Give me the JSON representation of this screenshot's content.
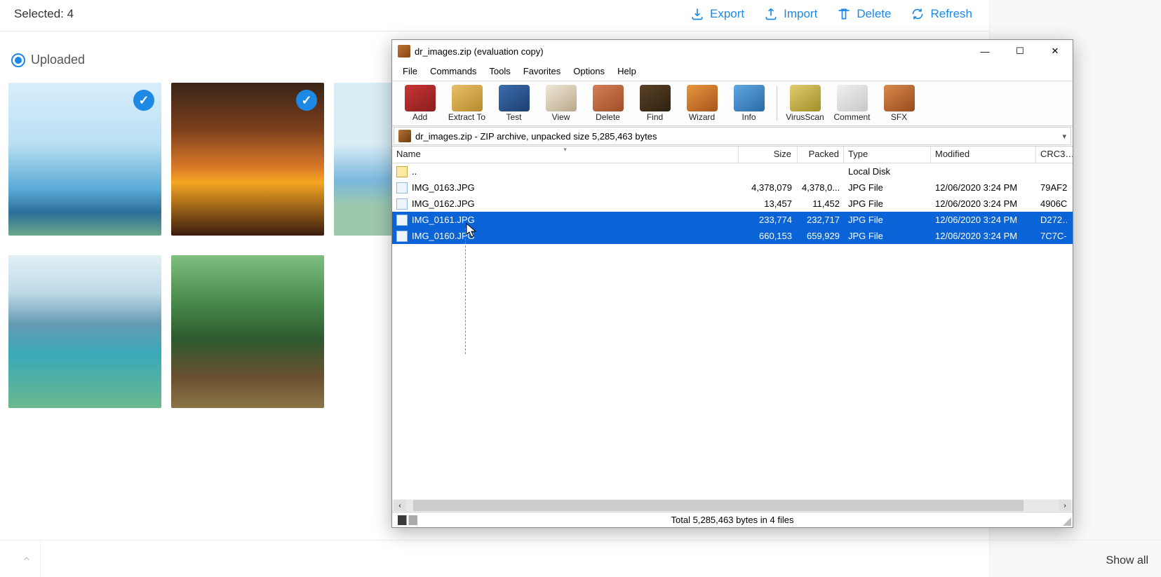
{
  "bg": {
    "selected_text": "Selected: 4",
    "actions": {
      "export": "Export",
      "import": "Import",
      "delete": "Delete",
      "refresh": "Refresh"
    },
    "uploaded_label": "Uploaded",
    "show_all": "Show all"
  },
  "winrar": {
    "title": "dr_images.zip (evaluation copy)",
    "menu": {
      "file": "File",
      "commands": "Commands",
      "tools": "Tools",
      "favorites": "Favorites",
      "options": "Options",
      "help": "Help"
    },
    "toolbar": {
      "add": "Add",
      "extract": "Extract To",
      "test": "Test",
      "view": "View",
      "delete": "Delete",
      "find": "Find",
      "wizard": "Wizard",
      "info": "Info",
      "virus": "VirusScan",
      "comment": "Comment",
      "sfx": "SFX"
    },
    "path": "dr_images.zip - ZIP archive, unpacked size 5,285,463 bytes",
    "cols": {
      "name": "Name",
      "size": "Size",
      "packed": "Packed",
      "type": "Type",
      "modified": "Modified",
      "crc": "CRC3…"
    },
    "rows": {
      "parent": {
        "name": "..",
        "type": "Local Disk"
      },
      "r1": {
        "name": "IMG_0163.JPG",
        "size": "4,378,079",
        "packed": "4,378,0...",
        "type": "JPG File",
        "mod": "12/06/2020 3:24 PM",
        "crc": "79AF2"
      },
      "r2": {
        "name": "IMG_0162.JPG",
        "size": "13,457",
        "packed": "11,452",
        "type": "JPG File",
        "mod": "12/06/2020 3:24 PM",
        "crc": "4906C"
      },
      "r3": {
        "name": "IMG_0161.JPG",
        "size": "233,774",
        "packed": "232,717",
        "type": "JPG File",
        "mod": "12/06/2020 3:24 PM",
        "crc": "D272…"
      },
      "r4": {
        "name": "IMG_0160.JPG",
        "size": "660,153",
        "packed": "659,929",
        "type": "JPG File",
        "mod": "12/06/2020 3:24 PM",
        "crc": "7C7C-"
      }
    },
    "status": "Total 5,285,463 bytes in 4 files"
  }
}
